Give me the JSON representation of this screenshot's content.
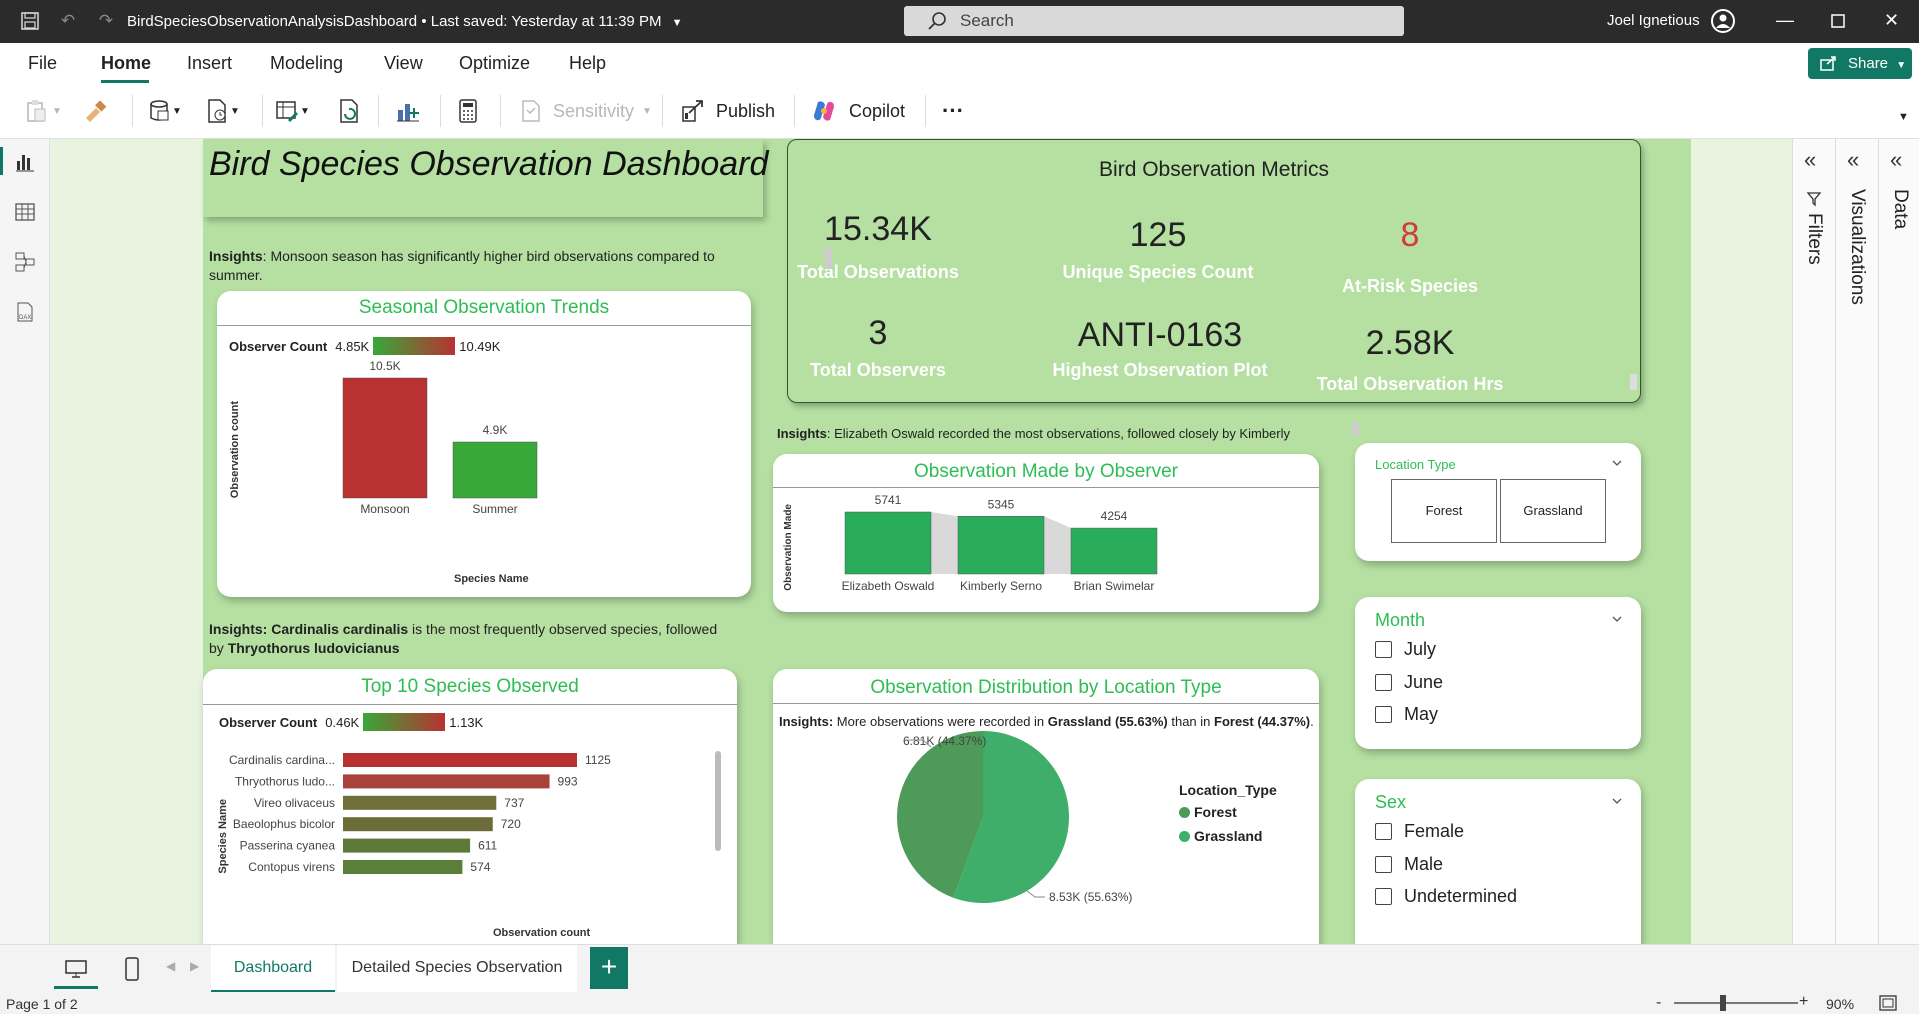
{
  "titlebar": {
    "doc_title": "BirdSpeciesObservationAnalysisDashboard  •  Last saved: Yesterday at 11:39 PM",
    "search_placeholder": "Search",
    "user_name": "Joel Ignetious"
  },
  "menu": {
    "items": [
      "File",
      "Home",
      "Insert",
      "Modeling",
      "View",
      "Optimize",
      "Help"
    ],
    "active": "Home",
    "share_label": "Share"
  },
  "ribbon": {
    "sensitivity_label": "Sensitivity",
    "publish_label": "Publish",
    "copilot_label": "Copilot",
    "more_label": "···"
  },
  "panes": {
    "filters_label": "Filters",
    "visualizations_label": "Visualizations",
    "data_label": "Data"
  },
  "report": {
    "title": "Bird Species Observation Dashboard",
    "insight_seasonal_bold": "Insights",
    "insight_seasonal_text": ": Monsoon season has significantly higher bird observations compared to summer.",
    "insight_observer_bold": "Insights",
    "insight_observer_text": ": Elizabeth Oswald recorded the most observations, followed closely by Kimberly",
    "insight_species_bold1": "Insights: Cardinalis cardinalis",
    "insight_species_text": " is the most frequently observed species, followed by ",
    "insight_species_bold2": "Thryothorus ludovicianus",
    "insight_location_bold": "Insights:",
    "insight_location_text1": " More observations were recorded in ",
    "insight_location_bold2": "Grassland (55.63%)",
    "insight_location_text2": " than in ",
    "insight_location_bold3": "Forest (44.37%)",
    "insight_location_text3": "."
  },
  "metrics": {
    "title": "Bird Observation Metrics",
    "items": [
      {
        "value": "15.34K",
        "label": "Total Observations"
      },
      {
        "value": "125",
        "label": "Unique Species Count"
      },
      {
        "value": "8",
        "label": "At-Risk Species"
      },
      {
        "value": "3",
        "label": "Total Observers"
      },
      {
        "value": "ANTI-0163",
        "label": "Highest Observation Plot"
      },
      {
        "value": "2.58K",
        "label": "Total Observation Hrs"
      }
    ],
    "alert_color": "#d43a3a"
  },
  "legend_gradient": {
    "label": "Observer Count",
    "seasonal_min": "4.85K",
    "seasonal_max": "10.49K",
    "species_min": "0.46K",
    "species_max": "1.13K"
  },
  "chart_data": [
    {
      "type": "bar",
      "title": "Seasonal Observation Trends",
      "categories": [
        "Monsoon",
        "Summer"
      ],
      "values": [
        10500,
        4900
      ],
      "data_labels": [
        "10.5K",
        "4.9K"
      ],
      "xlabel": "Species Name",
      "ylabel": "Observation count",
      "colors": [
        "#b83232",
        "#38a838"
      ]
    },
    {
      "type": "bar",
      "title": "Observation Made by Observer",
      "categories": [
        "Elizabeth Oswald",
        "Kimberly Serno",
        "Brian Swimelar"
      ],
      "values": [
        5741,
        5345,
        4254
      ],
      "ylabel": "Observation Made",
      "colors": [
        "#2aad5a",
        "#2aad5a",
        "#2aad5a"
      ]
    },
    {
      "type": "bar",
      "orientation": "horizontal",
      "title": "Top 10 Species Observed",
      "categories": [
        "Cardinalis cardina...",
        "Thryothorus ludo...",
        "Vireo olivaceus",
        "Baeolophus bicolor",
        "Passerina cyanea",
        "Contopus virens"
      ],
      "values": [
        1125,
        993,
        737,
        720,
        611,
        574
      ],
      "xlabel": "Observation count",
      "ylabel": "Species Name",
      "colors": [
        "#b83232",
        "#a9423a",
        "#6f6f3a",
        "#6d6d3a",
        "#5e7a3a",
        "#5a7f3a"
      ]
    },
    {
      "type": "pie",
      "title": "Observation Distribution by Location Type",
      "legend_title": "Location_Type",
      "categories": [
        "Forest",
        "Grassland"
      ],
      "values": [
        6810,
        8530
      ],
      "percentages": [
        44.37,
        55.63
      ],
      "data_labels": [
        "6.81K (44.37%)",
        "8.53K (55.63%)"
      ],
      "colors": [
        "#4e9a58",
        "#3fae6b"
      ]
    }
  ],
  "slicers": {
    "location_type": {
      "title": "Location Type",
      "options": [
        "Forest",
        "Grassland"
      ]
    },
    "month": {
      "title": "Month",
      "options": [
        "July",
        "June",
        "May"
      ]
    },
    "sex": {
      "title": "Sex",
      "options": [
        "Female",
        "Male",
        "Undetermined"
      ]
    }
  },
  "tabs": {
    "items": [
      "Dashboard",
      "Detailed Species Observation"
    ],
    "active": "Dashboard",
    "add_label": "+"
  },
  "status": {
    "page": "Page 1 of 2",
    "zoom": "90%",
    "zoom_minus": "-",
    "zoom_plus": "+"
  },
  "colors": {
    "accent": "#117865",
    "report_bg": "#b5e0a2",
    "title_green": "#2ebd55"
  }
}
